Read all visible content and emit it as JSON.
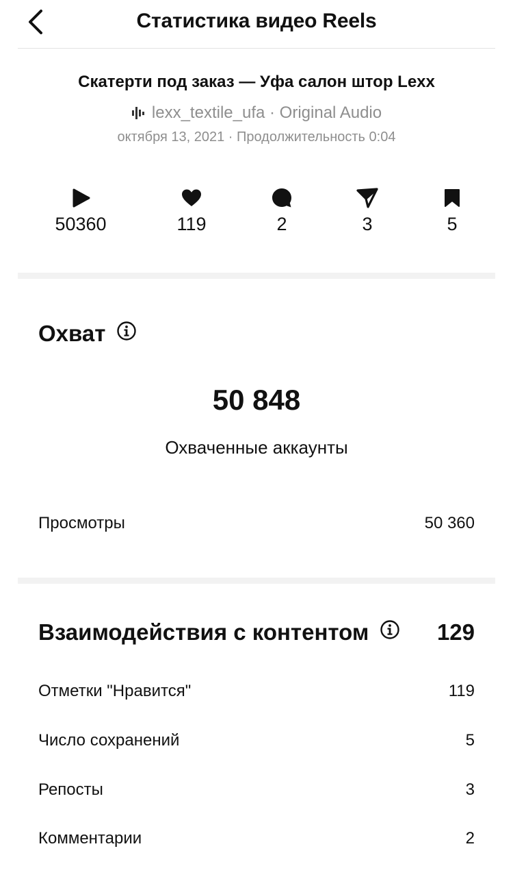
{
  "header": {
    "title": "Статистика видео Reels",
    "back_icon": "chevron-left-icon"
  },
  "reel": {
    "title": "Скатерти под заказ — Уфа салон штор Lexx",
    "audio": "lexx_textile_ufa · Original Audio",
    "audio_icon": "audio-wave-icon",
    "meta": "октября 13, 2021 · Продолжительность 0:04"
  },
  "stats": {
    "plays": "50360",
    "likes": "119",
    "comments": "2",
    "shares": "3",
    "saves": "5"
  },
  "reach": {
    "heading": "Охват",
    "number": "50 848",
    "label": "Охваченные аккаунты",
    "views_label": "Просмотры",
    "views_value": "50 360"
  },
  "interactions": {
    "heading": "Взаимодействия с контентом",
    "total": "129",
    "rows": [
      {
        "label": "Отметки \"Нравится\"",
        "value": "119"
      },
      {
        "label": "Число сохранений",
        "value": "5"
      },
      {
        "label": "Репосты",
        "value": "3"
      },
      {
        "label": "Комментарии",
        "value": "2"
      }
    ]
  },
  "colors": {
    "text": "#111111",
    "muted": "#8e8e8e",
    "separator": "#f2f2f2"
  }
}
